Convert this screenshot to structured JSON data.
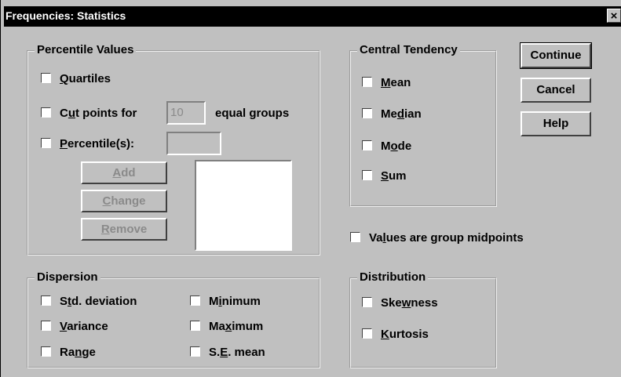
{
  "title": "Frequencies: Statistics",
  "close_label": "×",
  "percentile_values": {
    "legend": "Percentile Values",
    "quartiles": {
      "pre": "",
      "key": "Q",
      "post": "uartiles"
    },
    "cut_points": {
      "pre": "C",
      "key": "u",
      "post": "t points for",
      "value": "10",
      "suffix": "equal groups"
    },
    "percentiles": {
      "pre": "",
      "key": "P",
      "post": "ercentile(s):",
      "value": ""
    },
    "add": {
      "pre": "",
      "key": "A",
      "post": "dd"
    },
    "change": {
      "pre": "",
      "key": "C",
      "post": "hange"
    },
    "remove": {
      "pre": "",
      "key": "R",
      "post": "emove"
    }
  },
  "central_tendency": {
    "legend": "Central Tendency",
    "mean": {
      "pre": "",
      "key": "M",
      "post": "ean"
    },
    "median": {
      "pre": "Me",
      "key": "d",
      "post": "ian"
    },
    "mode": {
      "pre": "M",
      "key": "o",
      "post": "de"
    },
    "sum": {
      "pre": "",
      "key": "S",
      "post": "um"
    }
  },
  "buttons": {
    "continue": "Continue",
    "cancel": "Cancel",
    "help": "Help"
  },
  "group_midpoints": {
    "pre": "Va",
    "key": "l",
    "post": "ues are group midpoints"
  },
  "dispersion": {
    "legend": "Dispersion",
    "std_deviation": {
      "pre": "S",
      "key": "t",
      "post": "d. deviation"
    },
    "variance": {
      "pre": "",
      "key": "V",
      "post": "ariance"
    },
    "range": {
      "pre": "Ra",
      "key": "n",
      "post": "ge"
    },
    "minimum": {
      "pre": "M",
      "key": "i",
      "post": "nimum"
    },
    "maximum": {
      "pre": "Ma",
      "key": "x",
      "post": "imum"
    },
    "se_mean": {
      "pre": "S.",
      "key": "E",
      "post": ". mean"
    }
  },
  "distribution": {
    "legend": "Distribution",
    "skewness": {
      "pre": "Ske",
      "key": "w",
      "post": "ness"
    },
    "kurtosis": {
      "pre": "",
      "key": "K",
      "post": "urtosis"
    }
  },
  "colors": {
    "face": "#c0c0c0",
    "titlebar": "#000000",
    "disabled_text": "#8a8a8a"
  }
}
